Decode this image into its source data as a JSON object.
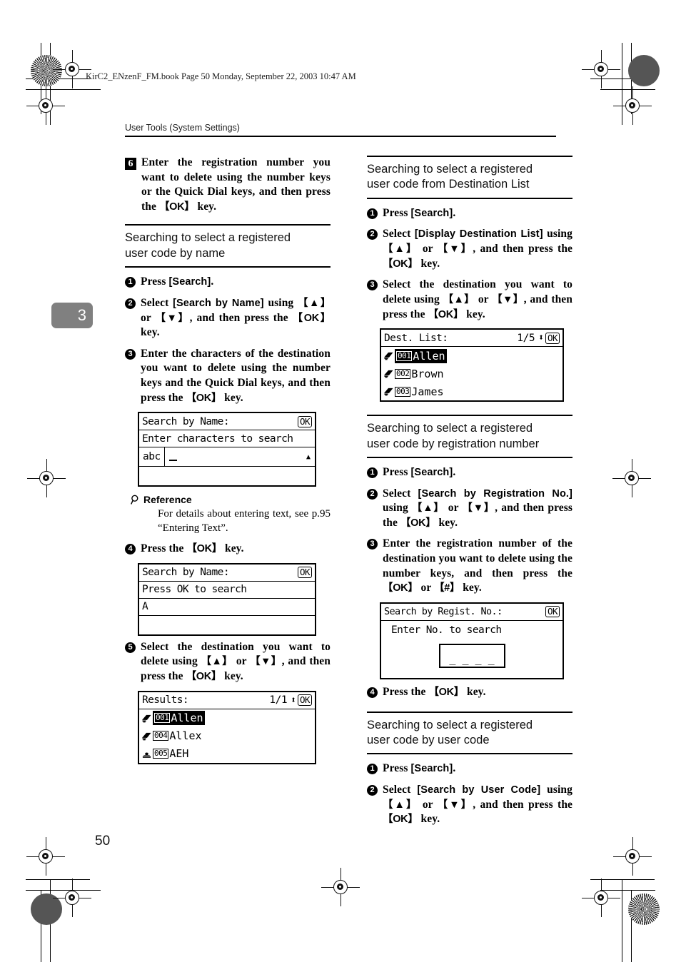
{
  "printer_slug": "KirC2_ENzenF_FM.book  Page 50  Monday, September 22, 2003  10:47 AM",
  "running_head": "User Tools (System Settings)",
  "chapter_tab": "3",
  "folio": "50",
  "left_column": {
    "step6": {
      "number": "6",
      "text_before_key": "Enter the registration number you want to delete using the number keys or the Quick Dial keys, and then press the ",
      "key": "OK",
      "text_after_key": " key."
    },
    "section": {
      "title_line1": "Searching to select a registered",
      "title_line2": "user code by name"
    },
    "steps": [
      {
        "number": "1",
        "parts": [
          "Press ",
          "[Search]",
          "."
        ]
      },
      {
        "number": "2",
        "parts": [
          "Select ",
          "[Search by Name]",
          " using ",
          "OK",
          "."
        ]
      },
      {
        "number": "3",
        "text": "Enter the characters of the destination you want to delete using the number keys and the Quick Dial keys, and then press the ",
        "key": "OK",
        "tail": " key."
      }
    ],
    "step2_full": "Select [Search by Name] using {▲} or {▼}, and then press the {OK} key.",
    "lcd_search_by_name": {
      "title": "Search by Name:",
      "ok": "OK",
      "prompt": "Enter characters to search",
      "mode": "abc",
      "cursor": "_",
      "scroll_glyph": "▲"
    },
    "reference": {
      "label": "Reference",
      "text": "For details about entering text, see p.95 “Entering Text”."
    },
    "step4": {
      "number": "4",
      "text": "Press the ",
      "key": "OK",
      "tail": " key."
    },
    "lcd_press_ok": {
      "title": "Search by Name:",
      "ok": "OK",
      "prompt": "Press OK to search",
      "value": "A"
    },
    "step5": {
      "number": "5",
      "text": "Select the destination you want to delete using {▲} or {▼}, and then press the {OK} key."
    },
    "lcd_results": {
      "title": "Results:",
      "page": "1/1",
      "updown": "⬍",
      "ok": "OK",
      "rows": [
        {
          "icon": "fax-destination-icon",
          "id": "001",
          "name": "Allen",
          "selected": true
        },
        {
          "icon": "fax-destination-icon",
          "id": "004",
          "name": "Allex",
          "selected": false
        },
        {
          "icon": "telephone-icon",
          "id": "005",
          "name": "AEH",
          "selected": false
        }
      ]
    }
  },
  "right_column": {
    "section1": {
      "title_line1": "Searching to select a registered",
      "title_line2": "user code from Destination List",
      "steps": {
        "s1": {
          "number": "1",
          "text": "Press ",
          "kw": "[Search]",
          "tail": "."
        },
        "s2": {
          "number": "2",
          "text": "Select ",
          "kw": "[Display Destination List]",
          "tail": " using {▲} or {▼}, and then press the {OK} key."
        },
        "s3": {
          "number": "3",
          "text": "Select the destination you want to delete using {▲} or {▼}, and then press the {OK} key."
        }
      },
      "lcd_dest_list": {
        "title": "Dest. List:",
        "page": "1/5",
        "updown": "⬍",
        "ok": "OK",
        "rows": [
          {
            "icon": "fax-destination-icon",
            "id": "001",
            "name": "Allen",
            "selected": true
          },
          {
            "icon": "fax-destination-icon",
            "id": "002",
            "name": "Brown",
            "selected": false
          },
          {
            "icon": "fax-destination-icon",
            "id": "003",
            "name": "James",
            "selected": false
          }
        ]
      }
    },
    "section2": {
      "title_line1": "Searching to select a registered",
      "title_line2": "user code by registration number",
      "steps": {
        "s1": {
          "number": "1",
          "text": "Press ",
          "kw": "[Search]",
          "tail": "."
        },
        "s2": {
          "number": "2",
          "text": "Select ",
          "kw": "[Search by Registration No.]",
          "tail": " using {▲} or {▼}, and then press the {OK} key."
        },
        "s3": {
          "number": "3",
          "text": "Enter the registration number of the destination you want to delete using the number keys, and then press the {OK} or {#} key."
        }
      },
      "lcd_regist_no": {
        "title": "Search by Regist. No.:",
        "ok": "OK",
        "prompt": "Enter No. to search",
        "input_dashes": "_ _ _ _"
      },
      "step4": {
        "number": "4",
        "text": "Press the ",
        "key": "OK",
        "tail": " key."
      }
    },
    "section3": {
      "title_line1": "Searching to select a registered",
      "title_line2": "user code by user code",
      "steps": {
        "s1": {
          "number": "1",
          "text": "Press ",
          "kw": "[Search]",
          "tail": "."
        },
        "s2": {
          "number": "2",
          "text": "Select ",
          "kw": "[Search by User Code]",
          "tail": " using {▲} or {▼}, and then press the {OK} key."
        }
      }
    }
  },
  "keys": {
    "ok": "OK",
    "up": "▲",
    "down": "▼",
    "hash": "#"
  }
}
